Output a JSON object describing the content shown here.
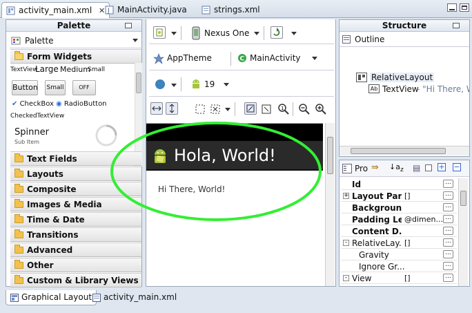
{
  "editor_tabs": [
    {
      "label": "activity_main.xml",
      "active": true
    },
    {
      "label": "MainActivity.java",
      "active": false
    },
    {
      "label": "strings.xml",
      "active": false
    }
  ],
  "palette": {
    "title": "Palette",
    "selector": "Palette",
    "form_widgets_label": "Form Widgets",
    "widgets": {
      "textview_label": "TextView",
      "large": "Large",
      "medium": "Medium",
      "small": "Small",
      "button": "Button",
      "small_button": "Small",
      "toggle_off": "OFF",
      "checkbox": "CheckBox",
      "radiobutton": "RadioButton",
      "checkedtextview": "CheckedTextView",
      "spinner": "Spinner",
      "spinner_sub": "Sub Item"
    },
    "categories": [
      "Text Fields",
      "Layouts",
      "Composite",
      "Images & Media",
      "Time & Date",
      "Transitions",
      "Advanced",
      "Other",
      "Custom & Library Views"
    ]
  },
  "canvas_toolbar": {
    "device": "Nexus One",
    "theme": "AppTheme",
    "activity": "MainActivity",
    "api_level": "19"
  },
  "device_preview": {
    "title": "Hola, World!",
    "body_text": "Hi There, World!"
  },
  "structure": {
    "title": "Structure",
    "outline_label": "Outline",
    "tree": [
      {
        "label": "RelativeLayout"
      },
      {
        "label": "TextView",
        "detail": " - \"Hi There, W"
      }
    ]
  },
  "properties": {
    "toolbar_label": "Pro",
    "rows": [
      {
        "name": "Id",
        "value": "",
        "bold": true,
        "expander": ""
      },
      {
        "name": "Layout Par...",
        "value": "[]",
        "bold": true,
        "expander": "+"
      },
      {
        "name": "Background",
        "value": "",
        "bold": true,
        "expander": ""
      },
      {
        "name": "Padding Left",
        "value": "@dimen...",
        "bold": true,
        "expander": ""
      },
      {
        "name": "Content D...",
        "value": "",
        "bold": true,
        "expander": ""
      },
      {
        "name": "RelativeLay...",
        "value": "[]",
        "bold": false,
        "expander": "-"
      },
      {
        "name": "Gravity",
        "value": "",
        "bold": false,
        "expander": "",
        "indent": true
      },
      {
        "name": "Ignore Gr...",
        "value": "",
        "bold": false,
        "expander": "",
        "indent": true
      },
      {
        "name": "View",
        "value": "[]",
        "bold": false,
        "expander": "-"
      }
    ]
  },
  "bottom_tabs": [
    {
      "label": "Graphical Layout",
      "active": true
    },
    {
      "label": "activity_main.xml",
      "active": false
    }
  ],
  "colors": {
    "highlight": "#33ee33",
    "android_green": "#a4c639",
    "title_bar": "#2a2a2a"
  }
}
